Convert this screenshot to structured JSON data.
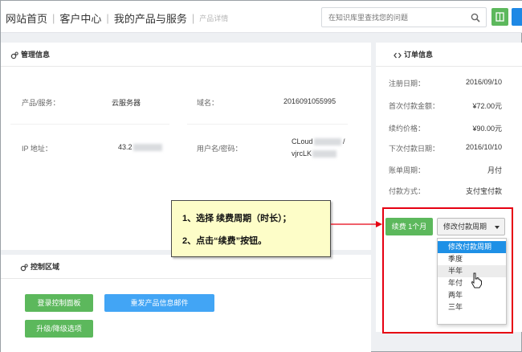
{
  "nav": {
    "home": "网站首页",
    "customer": "客户中心",
    "products": "我的产品与服务",
    "current": "产品详情"
  },
  "search": {
    "placeholder": "在知识库里查找您的问题"
  },
  "management": {
    "title": "管理信息",
    "product_label": "产品/服务：",
    "product_value": "云服务器",
    "domain_label": "域名：",
    "domain_value": "2016091055995",
    "ip_label": "IP 地址：",
    "ip_value": "43.2",
    "user_label": "用户名/密码：",
    "user_line1": "CLoud",
    "user_slash": "/",
    "user_line2": "vjrcLK"
  },
  "order": {
    "title": "订单信息",
    "rows": [
      {
        "label": "注册日期：",
        "value": "2016/09/10"
      },
      {
        "label": "首次付款金额：",
        "value": "¥72.00元"
      },
      {
        "label": "续约价格：",
        "value": "¥90.00元"
      },
      {
        "label": "下次付款日期：",
        "value": "2016/10/10"
      },
      {
        "label": "账单周期：",
        "value": "月付"
      },
      {
        "label": "付款方式：",
        "value": "支付宝付款"
      }
    ],
    "renew_button": "续费 1个月",
    "cycle_button": "修改付款周期",
    "menu": [
      "修改付款周期",
      "季度",
      "半年",
      "年付",
      "两年",
      "三年"
    ]
  },
  "control": {
    "title": "控制区域",
    "login_button": "登录控制面板",
    "resend_button": "重发产品信息邮件",
    "upgrade_button": "升级/降级选项"
  },
  "callout": {
    "line1": "1、选择 续费周期（时长）；",
    "line2": "2、点击“续费”按钮。"
  },
  "colors": {
    "green": "#5cb85c",
    "blue": "#42a5f5",
    "highlight": "#e60012",
    "note": "#fdfdc8"
  }
}
